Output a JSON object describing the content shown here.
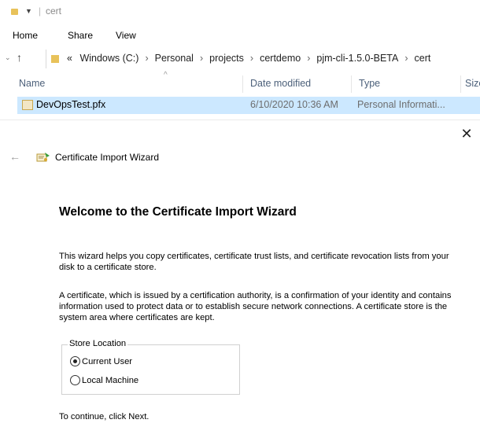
{
  "explorer": {
    "window_title": "cert",
    "ribbon_tabs": [
      "Home",
      "Share",
      "View"
    ],
    "breadcrumb": [
      "Windows (C:)",
      "Personal",
      "projects",
      "certdemo",
      "pjm-cli-1.5.0-BETA",
      "cert"
    ],
    "breadcrumb_prefix": "«",
    "columns": {
      "name": "Name",
      "date": "Date modified",
      "type": "Type",
      "size": "Size"
    },
    "files": [
      {
        "name": "DevOpsTest.pfx",
        "date": "6/10/2020 10:36 AM",
        "type": "Personal Informati..."
      }
    ]
  },
  "wizard": {
    "window_title": "Certificate Import Wizard",
    "close_glyph": "✕",
    "back_glyph": "←",
    "heading": "Welcome to the Certificate Import Wizard",
    "intro": "This wizard helps you copy certificates, certificate trust lists, and certificate revocation lists from your disk to a certificate store.",
    "description": "A certificate, which is issued by a certification authority, is a confirmation of your identity and contains information used to protect data or to establish secure network connections. A certificate store is the system area where certificates are kept.",
    "store_location": {
      "legend": "Store Location",
      "options": [
        {
          "label": "Current User",
          "selected": true
        },
        {
          "label": "Local Machine",
          "selected": false
        }
      ]
    },
    "continue_text": "To continue, click Next."
  }
}
